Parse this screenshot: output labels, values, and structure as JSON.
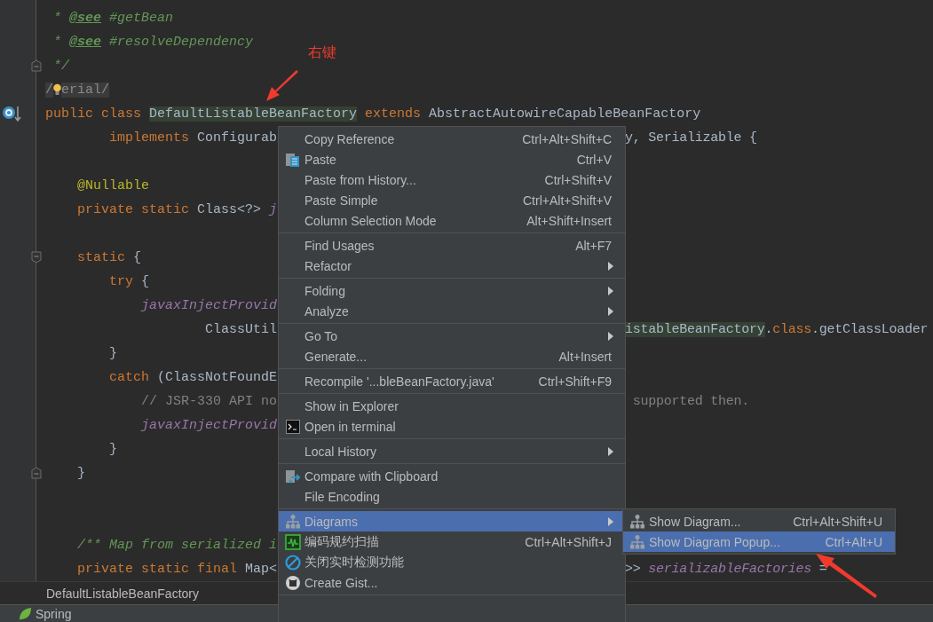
{
  "editor": {
    "lines": [
      {
        "kind": "text",
        "left": [
          [
            {
              "kind": "doc",
              "t": " * "
            },
            {
              "kind": "doctag",
              "t": "@see"
            },
            {
              "kind": "doc",
              "t": " #getBean"
            }
          ]
        ]
      },
      {
        "kind": "text",
        "left": [
          [
            {
              "kind": "doc",
              "t": " * "
            },
            {
              "kind": "doctag",
              "t": "@see"
            },
            {
              "kind": "doc",
              "t": " #resolveDependency"
            }
          ]
        ]
      },
      {
        "kind": "fold-end",
        "left": [
          [
            {
              "kind": "doc",
              "t": " */"
            }
          ]
        ]
      },
      {
        "kind": "bulb",
        "left": [
          [
            {
              "kind": "muted",
              "t": "/"
            }
          ],
          [
            {
              "kind": "muted",
              "t": "erial/"
            }
          ]
        ]
      },
      {
        "kind": "override",
        "left": [
          [
            {
              "kind": "kw",
              "t": "public class "
            },
            {
              "kind": "ref",
              "t": "DefaultListableBeanFactory"
            },
            {
              "kind": "kw",
              "t": " extends"
            },
            {
              "kind": "plain",
              "t": " AbstractAutowireCapableBeanFactory"
            }
          ]
        ]
      },
      {
        "kind": "text",
        "left": [
          [
            {
              "kind": "kw",
              "t": "        implements"
            },
            {
              "kind": "plain",
              "t": " Configurab"
            }
          ]
        ],
        "right": [
          [
            {
              "kind": "plain",
              "t": "y, Serializable {"
            }
          ]
        ]
      },
      {
        "kind": "text"
      },
      {
        "kind": "text",
        "left": [
          [
            {
              "kind": "anno",
              "t": "    @Nullable"
            }
          ]
        ]
      },
      {
        "kind": "text",
        "left": [
          [
            {
              "kind": "kw",
              "t": "    private static "
            },
            {
              "kind": "plain",
              "t": "Class<?> "
            },
            {
              "kind": "field",
              "t": "j"
            }
          ]
        ]
      },
      {
        "kind": "text"
      },
      {
        "kind": "fold-start",
        "left": [
          [
            {
              "kind": "kw",
              "t": "    static"
            },
            {
              "kind": "plain",
              "t": " {"
            }
          ]
        ]
      },
      {
        "kind": "text",
        "left": [
          [
            {
              "kind": "kw",
              "t": "        try"
            },
            {
              "kind": "plain",
              "t": " {"
            }
          ]
        ]
      },
      {
        "kind": "text",
        "left": [
          [
            {
              "kind": "field",
              "t": "            javaxInjectProvid"
            }
          ]
        ]
      },
      {
        "kind": "text",
        "left": [
          [
            {
              "kind": "plain",
              "t": "                    ClassUtil"
            }
          ]
        ],
        "right": [
          [
            {
              "kind": "ref",
              "t": "istableBeanFactory"
            },
            {
              "kind": "plain",
              "t": "."
            },
            {
              "kind": "kw",
              "t": "class"
            },
            {
              "kind": "plain",
              "t": ".getClassLoader"
            }
          ]
        ]
      },
      {
        "kind": "text",
        "left": [
          [
            {
              "kind": "plain",
              "t": "        }"
            }
          ]
        ]
      },
      {
        "kind": "text",
        "left": [
          [
            {
              "kind": "kw",
              "t": "        catch"
            },
            {
              "kind": "plain",
              "t": " (ClassNotFoundE"
            }
          ]
        ]
      },
      {
        "kind": "text",
        "left": [
          [
            {
              "kind": "comment",
              "t": "            // JSR-330 API no"
            }
          ]
        ],
        "right": [
          [
            {
              "kind": "comment",
              "t": " supported then."
            }
          ]
        ]
      },
      {
        "kind": "text",
        "left": [
          [
            {
              "kind": "field",
              "t": "            javaxInjectProvid"
            }
          ]
        ]
      },
      {
        "kind": "text",
        "left": [
          [
            {
              "kind": "plain",
              "t": "        }"
            }
          ]
        ]
      },
      {
        "kind": "fold-end",
        "left": [
          [
            {
              "kind": "plain",
              "t": "    }"
            }
          ]
        ]
      },
      {
        "kind": "text"
      },
      {
        "kind": "text"
      },
      {
        "kind": "text",
        "left": [
          [
            {
              "kind": "doc",
              "t": "    /** Map from serialized i"
            }
          ]
        ]
      },
      {
        "kind": "text",
        "left": [
          [
            {
              "kind": "kw",
              "t": "    private static final "
            },
            {
              "kind": "plain",
              "t": "Map<"
            }
          ]
        ],
        "right": [
          [
            {
              "kind": "plain",
              "t": ">> "
            },
            {
              "kind": "field",
              "t": "serializableFactories"
            },
            {
              "kind": "plain",
              "t": " ="
            }
          ]
        ]
      }
    ]
  },
  "context_menu": {
    "groups": [
      [
        {
          "label": "Copy Reference",
          "shortcut": "Ctrl+Alt+Shift+C",
          "kind": "plain",
          "submenu": false,
          "selected": false
        },
        {
          "label": "Paste",
          "shortcut": "Ctrl+V",
          "kind": "paste",
          "submenu": false,
          "selected": false
        },
        {
          "label": "Paste from History...",
          "shortcut": "Ctrl+Shift+V",
          "kind": "plain",
          "submenu": false,
          "selected": false
        },
        {
          "label": "Paste Simple",
          "shortcut": "Ctrl+Alt+Shift+V",
          "kind": "plain",
          "submenu": false,
          "selected": false
        },
        {
          "label": "Column Selection Mode",
          "shortcut": "Alt+Shift+Insert",
          "kind": "plain",
          "submenu": false,
          "selected": false
        }
      ],
      [
        {
          "label": "Find Usages",
          "shortcut": "Alt+F7",
          "kind": "plain",
          "submenu": false,
          "selected": false
        },
        {
          "label": "Refactor",
          "kind": "plain",
          "submenu": true,
          "selected": false
        }
      ],
      [
        {
          "label": "Folding",
          "kind": "plain",
          "submenu": true,
          "selected": false
        },
        {
          "label": "Analyze",
          "kind": "plain",
          "submenu": true,
          "selected": false
        }
      ],
      [
        {
          "label": "Go To",
          "kind": "plain",
          "submenu": true,
          "selected": false
        },
        {
          "label": "Generate...",
          "shortcut": "Alt+Insert",
          "kind": "plain",
          "submenu": false,
          "selected": false
        }
      ],
      [
        {
          "label": "Recompile '...bleBeanFactory.java'",
          "shortcut": "Ctrl+Shift+F9",
          "kind": "plain",
          "submenu": false,
          "selected": false
        }
      ],
      [
        {
          "label": "Show in Explorer",
          "kind": "plain",
          "submenu": false,
          "selected": false
        },
        {
          "label": "Open in terminal",
          "kind": "terminal",
          "submenu": false,
          "selected": false
        }
      ],
      [
        {
          "label": "Local History",
          "kind": "plain",
          "submenu": true,
          "selected": false
        }
      ],
      [
        {
          "label": "Compare with Clipboard",
          "kind": "compare",
          "submenu": false,
          "selected": false
        },
        {
          "label": "File Encoding",
          "kind": "plain",
          "submenu": false,
          "selected": false
        }
      ],
      [
        {
          "label": "Diagrams",
          "kind": "diagram",
          "submenu": true,
          "selected": true,
          "submenu_items": [
            {
              "label": "Show Diagram...",
              "shortcut": "Ctrl+Alt+Shift+U",
              "kind": "diagram",
              "selected": false
            },
            {
              "label": "Show Diagram Popup...",
              "shortcut": "Ctrl+Alt+U",
              "kind": "diagram",
              "selected": true
            }
          ]
        },
        {
          "label": "编码规约扫描",
          "shortcut": "Ctrl+Alt+Shift+J",
          "kind": "scan",
          "submenu": false,
          "selected": false
        },
        {
          "label": "关闭实时检测功能",
          "kind": "ban",
          "submenu": false,
          "selected": false
        },
        {
          "label": "Create Gist...",
          "kind": "github",
          "submenu": false,
          "selected": false
        }
      ]
    ]
  },
  "note": {
    "label": "右键"
  },
  "breadcrumb": {
    "text": "DefaultListableBeanFactory"
  },
  "tool_window_bar": {
    "items": [
      {
        "label": "Spring"
      }
    ]
  }
}
